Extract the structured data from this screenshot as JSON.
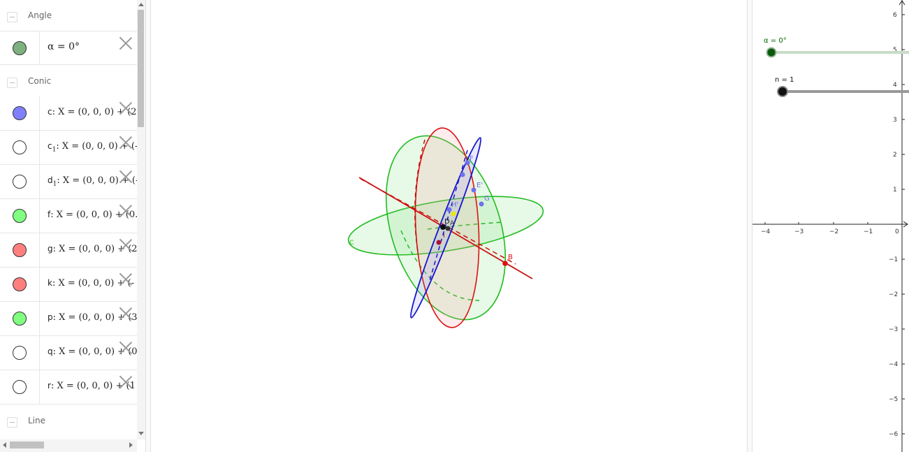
{
  "algebra": {
    "groups": [
      {
        "title": "Angle"
      },
      {
        "title": "Conic"
      },
      {
        "title": "Line"
      }
    ],
    "angle_rows": [
      {
        "name": "α",
        "expr": " = 0°",
        "color": "#7fb07f"
      }
    ],
    "conic_rows": [
      {
        "name": "c",
        "expr": ": X = (0, 0, 0) + (2",
        "color": "#8080ff"
      },
      {
        "name": "c",
        "sub": "1",
        "expr": ": X = (0, 0, 0) + (-",
        "color": "#ffffff"
      },
      {
        "name": "d",
        "sub": "1",
        "expr": ": X = (0, 0, 0) + (-",
        "color": "#ffffff"
      },
      {
        "name": "f",
        "expr": ": X = (0, 0, 0) + (0.",
        "color": "#80ff80"
      },
      {
        "name": "g",
        "expr": ": X = (0, 0, 0) + (2",
        "color": "#ff7f7f"
      },
      {
        "name": "k",
        "expr": ": X = (0, 0, 0) + (-",
        "color": "#ff7f7f"
      },
      {
        "name": "p",
        "expr": ": X = (0, 0, 0) + (3",
        "color": "#80ff80"
      },
      {
        "name": "q",
        "expr": ": X = (0, 0, 0) + (0",
        "color": "#ffffff"
      },
      {
        "name": "r",
        "expr": ": X = (0, 0, 0) + (1",
        "color": "#ffffff"
      }
    ]
  },
  "view3d": {
    "point_labels": [
      "F",
      "E'",
      "G",
      "H'",
      "D",
      "A'",
      "B",
      "I",
      "C"
    ]
  },
  "view2d": {
    "slider_alpha": {
      "label": "α = 0°",
      "color": "#006400",
      "value": 0
    },
    "slider_n": {
      "label": "n = 1",
      "color": "#000000",
      "value": 1
    },
    "x_ticks": [
      "−4",
      "−3",
      "−2",
      "−1",
      "0"
    ],
    "y_ticks": [
      "6",
      "5",
      "4",
      "3",
      "2",
      "1",
      "−1",
      "−2",
      "−3",
      "−4",
      "−5",
      "−6"
    ]
  }
}
